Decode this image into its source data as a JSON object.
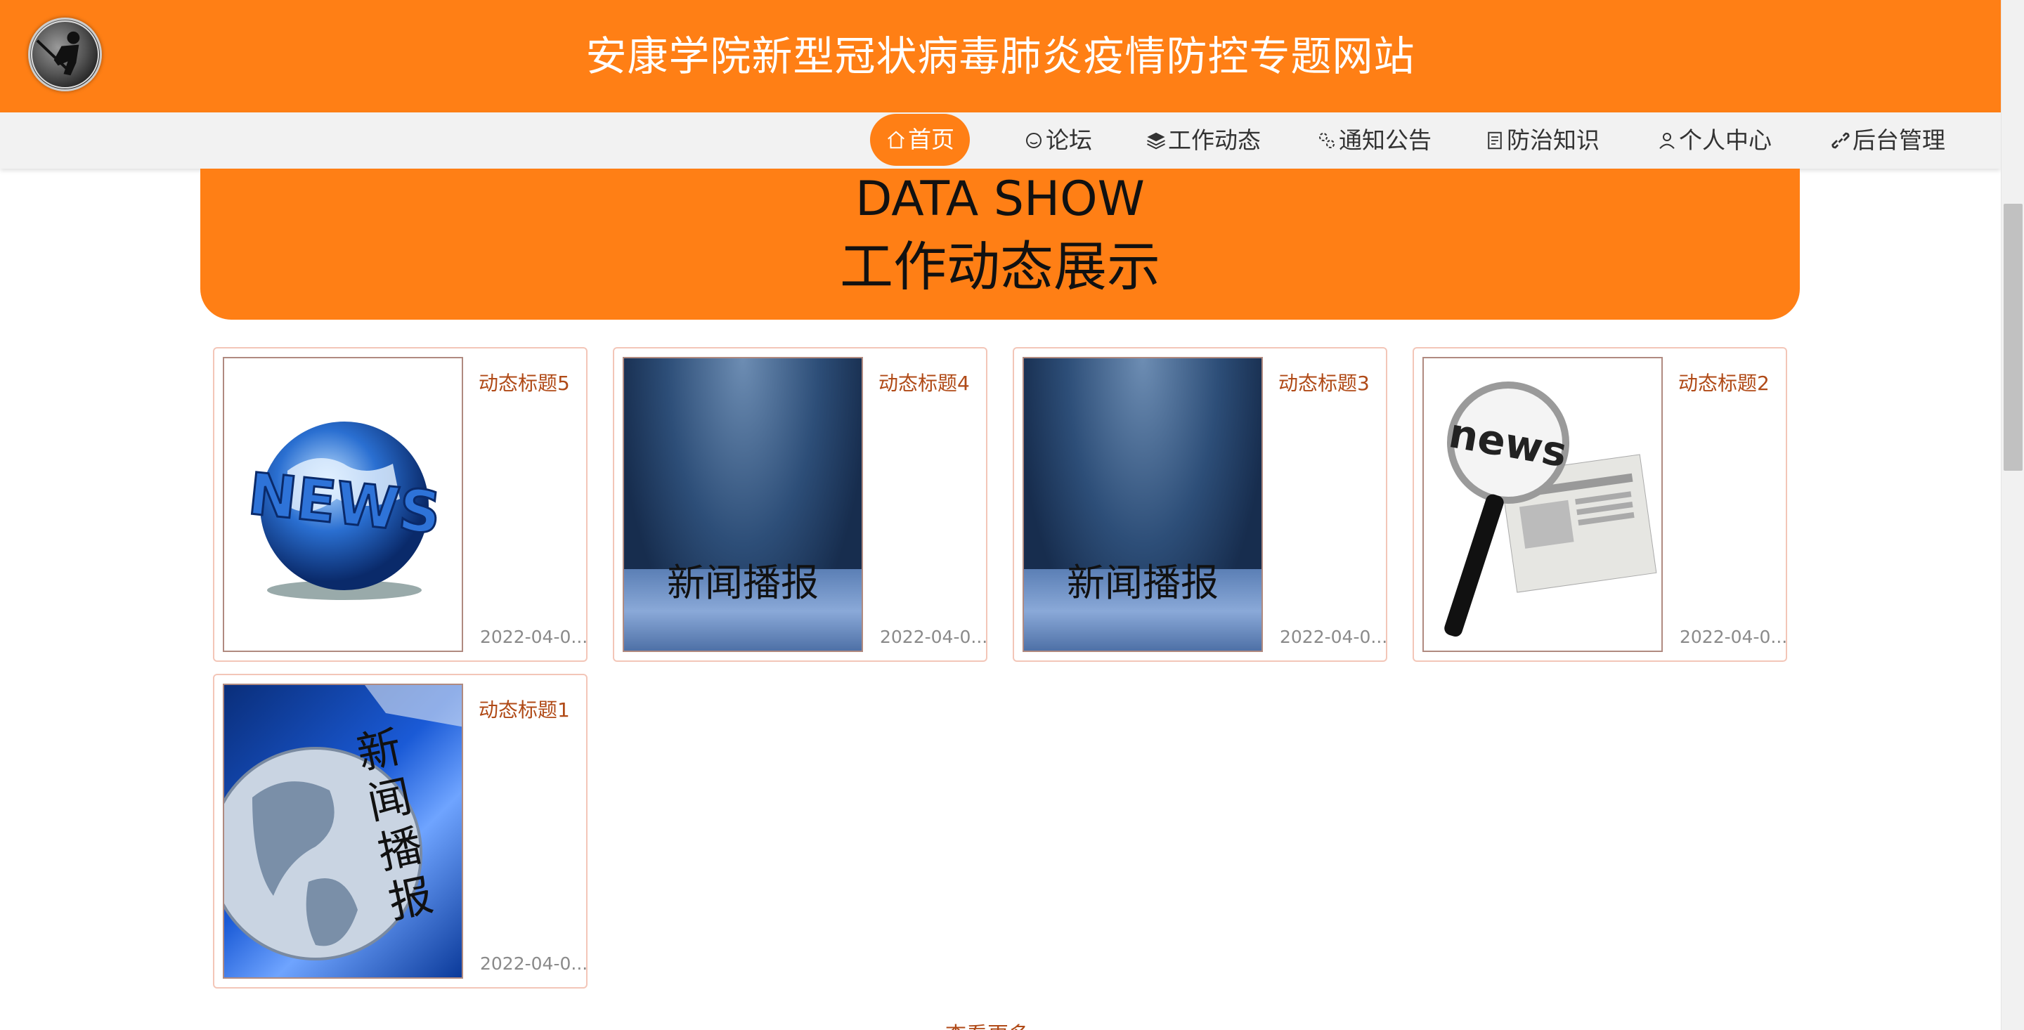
{
  "header": {
    "site_title": "安康学院新型冠状病毒肺炎疫情防控专题网站",
    "brand_color": "#ff7f15"
  },
  "nav": {
    "items": [
      {
        "label": "首页",
        "icon": "home-icon",
        "active": true
      },
      {
        "label": "论坛",
        "icon": "chat-icon",
        "active": false
      },
      {
        "label": "工作动态",
        "icon": "layers-icon",
        "active": false
      },
      {
        "label": "通知公告",
        "icon": "megaphone-icon",
        "active": false
      },
      {
        "label": "防治知识",
        "icon": "document-icon",
        "active": false
      },
      {
        "label": "个人中心",
        "icon": "user-icon",
        "active": false
      },
      {
        "label": "后台管理",
        "icon": "link-icon",
        "active": false
      }
    ]
  },
  "banner": {
    "title_en": "DATA SHOW",
    "title_cn": "工作动态展示"
  },
  "cards": [
    {
      "title": "动态标题5",
      "date": "2022-04-0...",
      "image": "news-globe-image"
    },
    {
      "title": "动态标题4",
      "date": "2022-04-0...",
      "image": "news-stage-image",
      "image_text": "新闻播报"
    },
    {
      "title": "动态标题3",
      "date": "2022-04-0...",
      "image": "news-stage-image",
      "image_text": "新闻播报"
    },
    {
      "title": "动态标题2",
      "date": "2022-04-0...",
      "image": "magnifier-newspaper-image",
      "image_text": "news"
    },
    {
      "title": "动态标题1",
      "date": "2022-04-0...",
      "image": "earth-news-image",
      "image_text": "新闻播报"
    }
  ],
  "more_link": "查看更多 »"
}
